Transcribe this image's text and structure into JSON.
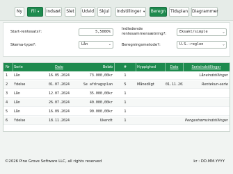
{
  "toolbar": {
    "ny": "Ny",
    "fil": "Fil",
    "indsaet": "Indsæt",
    "slet": "Slet",
    "udvid": "Udvid",
    "skjul": "Skjul",
    "indstillinger": "Indstillinger",
    "beregn": "Beregn",
    "tidsplan": "Tidsplan",
    "diagrammer": "Diagrammer",
    "caret": "▾"
  },
  "form": {
    "start_label": "Start-rentesats?:",
    "start_value": "5,5000%",
    "skema_label": "Skema-type?:",
    "skema_value": "Lån",
    "indledende_label_line1": "Indledende",
    "indledende_label_line2": "rentesammensætning?:",
    "indledende_value": "Eksakt/simple",
    "beregning_label": "Beregningsmetode?:",
    "beregning_value": "U.S.-reglen",
    "chevron": "⌄"
  },
  "table": {
    "headers": {
      "nr": "Nr",
      "serie": "Serie",
      "dato": "Dato",
      "beloeb": "Beløb",
      "num": "#",
      "hyppighed": "Hyppighed",
      "dato2": "Dato",
      "serieindstillinger": "Serieindstillinger"
    },
    "rows": [
      {
        "nr": "1",
        "serie": "Lån",
        "dato": "16.05.2024",
        "beloeb": "73.000,00kr",
        "num": "1",
        "hyppighed": "",
        "dato2": "",
        "indst": "Låneindstillinger"
      },
      {
        "nr": "2",
        "serie": "Ydelse",
        "dato": "01.07.2024",
        "beloeb": "Se afdragsplan",
        "num": "5",
        "hyppighed": "Månedligt",
        "dato2": "01.11.2024",
        "indst": "Rentekun-serie"
      },
      {
        "nr": "3",
        "serie": "Lån",
        "dato": "12.07.2024",
        "beloeb": "35.000,00kr",
        "num": "1",
        "hyppighed": "",
        "dato2": "",
        "indst": ""
      },
      {
        "nr": "4",
        "serie": "Lån",
        "dato": "26.07.2024",
        "beloeb": "40.000,00kr",
        "num": "1",
        "hyppighed": "",
        "dato2": "",
        "indst": ""
      },
      {
        "nr": "5",
        "serie": "Lån",
        "dato": "16.09.2024",
        "beloeb": "90.000,00kr",
        "num": "1",
        "hyppighed": "",
        "dato2": "",
        "indst": ""
      },
      {
        "nr": "6",
        "serie": "Ydelse",
        "dato": "18.11.2024",
        "beloeb": "Ukendt",
        "num": "1",
        "hyppighed": "",
        "dato2": "",
        "indst": "Pengestrømsindstillinger"
      }
    ]
  },
  "footer": {
    "copyright": "©2026 Pine Grove Software LLC, all rights reserved",
    "format": "kr : DD.MM.YYYY"
  },
  "colors": {
    "accent": "#1e8a4e",
    "background": "#f1f4f2"
  }
}
